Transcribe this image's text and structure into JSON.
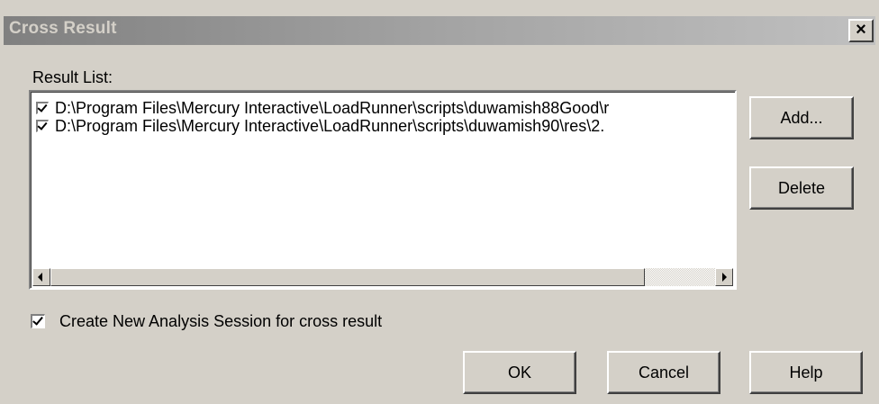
{
  "window": {
    "title": "Cross Result",
    "close_label": "×"
  },
  "result_list": {
    "label": "Result List:",
    "items": [
      {
        "checked": true,
        "text": "D:\\Program Files\\Mercury Interactive\\LoadRunner\\scripts\\duwamish88Good\\r"
      },
      {
        "checked": true,
        "text": "D:\\Program Files\\Mercury Interactive\\LoadRunner\\scripts\\duwamish90\\res\\2."
      }
    ]
  },
  "side_buttons": {
    "add_label": "Add...",
    "delete_label": "Delete"
  },
  "option": {
    "checked": true,
    "label": "Create New Analysis Session for cross result"
  },
  "footer_buttons": {
    "ok_label": "OK",
    "cancel_label": "Cancel",
    "help_label": "Help"
  }
}
